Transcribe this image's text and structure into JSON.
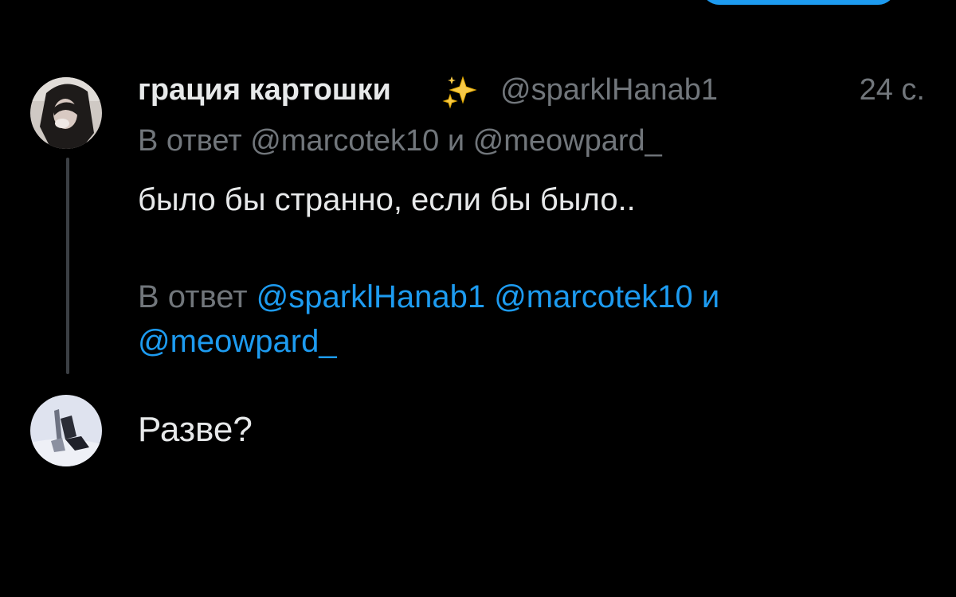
{
  "colors": {
    "background": "#000000",
    "text_primary": "#e7e9ea",
    "text_secondary": "#71767b",
    "accent": "#1d9bf0",
    "thread_line": "#3b3f44"
  },
  "top_button": {
    "icon": "reply-button-pill"
  },
  "tweet_1": {
    "avatar": "user-avatar-photo",
    "display_name": "грация картошки",
    "name_emoji": "sparkles-icon",
    "handle": "@sparklHanab1",
    "time": "24 с.",
    "replying_to": "В ответ @marcotek10 и @meowpard_",
    "text": "было бы странно, если бы было.."
  },
  "compose": {
    "reply_prefix": "В ответ",
    "mention_1": "@sparklHanab1",
    "mention_2": "@marcotek10",
    "conjunction": "и",
    "mention_3": "@meowpard_",
    "avatar": "own-avatar-photo",
    "text": "Разве?"
  }
}
